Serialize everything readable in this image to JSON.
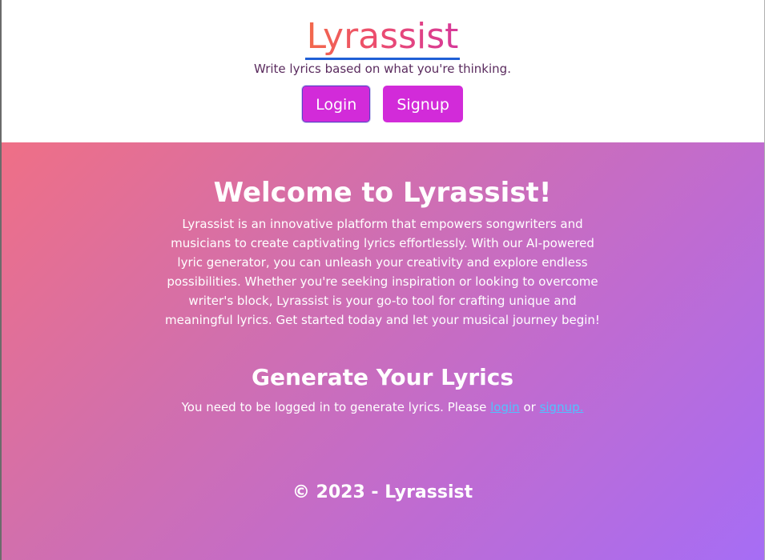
{
  "header": {
    "logo_text": "Lyrassist",
    "tagline": "Write lyrics based on what you're thinking.",
    "login_label": "Login",
    "signup_label": "Signup"
  },
  "main": {
    "welcome_title": "Welcome to Lyrassist!",
    "intro_text": "Lyrassist is an innovative platform that empowers songwriters and musicians to create captivating lyrics effortlessly. With our AI-powered lyric generator, you can unleash your creativity and explore endless possibilities. Whether you're seeking inspiration or looking to overcome writer's block, Lyrassist is your go-to tool for crafting unique and meaningful lyrics. Get started today and let your musical journey begin!",
    "generate_title": "Generate Your Lyrics",
    "generate_prefix": "You need to be logged in to generate lyrics. Please ",
    "login_link": "login",
    "generate_or": " or ",
    "signup_link": "signup."
  },
  "footer": {
    "text": "© 2023 - Lyrassist"
  },
  "colors": {
    "button_bg": "#d22bd9",
    "link": "#4fc3ff",
    "gradient_start": "#ef6f86",
    "gradient_end": "#a66df5",
    "logo_underline": "#1f5fd6"
  }
}
